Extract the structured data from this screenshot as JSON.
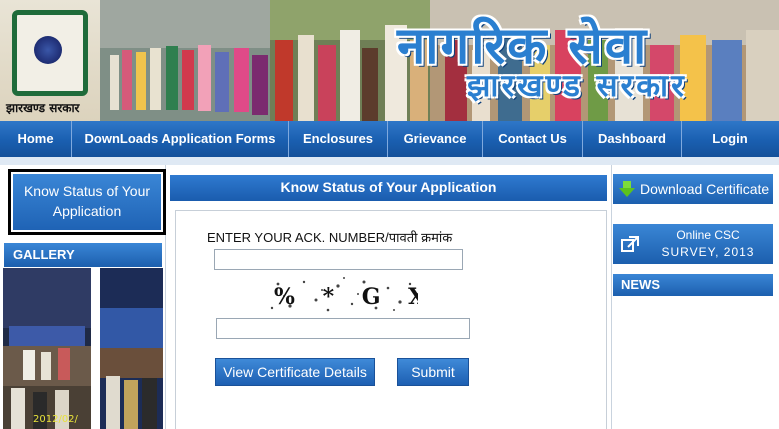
{
  "banner": {
    "title": "नागरिक सेवा",
    "subtitle": "झारखण्ड सरकार",
    "logo_text": "झारखण्ड सरकार"
  },
  "nav": {
    "items": [
      {
        "label": "Home"
      },
      {
        "label": "DownLoads Application Forms"
      },
      {
        "label": "Enclosures"
      },
      {
        "label": "Grievance"
      },
      {
        "label": "Contact Us"
      },
      {
        "label": "Dashboard"
      },
      {
        "label": "Login"
      }
    ]
  },
  "left": {
    "know_status": "Know Status of Your Application",
    "gallery_title": "GALLERY",
    "gallery_caption": "2012/02/"
  },
  "main": {
    "heading": "Know Status of Your Application",
    "ack_label": "ENTER YOUR ACK. NUMBER/पावती क्रमांक",
    "ack_value": "",
    "captcha_text": "% * G X",
    "captcha_value": "",
    "view_button": "View Certificate Details",
    "submit_button": "Submit"
  },
  "right": {
    "download_certificate": "Download Certificate",
    "csc_line1": "Online CSC",
    "csc_line2": "SURVEY, 2013",
    "news_title": "NEWS"
  },
  "colors": {
    "nav_blue": "#1a5fb0",
    "banner_text": "#2a7fd0",
    "logo_green": "#1f6b3a",
    "panel_blue": "#1c5fae"
  }
}
